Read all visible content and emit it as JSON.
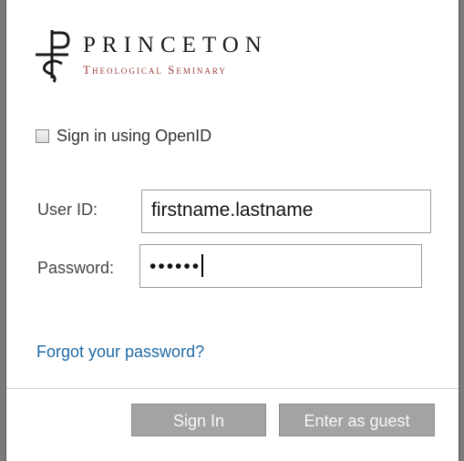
{
  "logo": {
    "name": "PRINCETON",
    "subtitle": "Theological Seminary"
  },
  "openid": {
    "label": "Sign in using OpenID"
  },
  "form": {
    "user_id_label": "User ID:",
    "user_id_value": "firstname.lastname",
    "password_label": "Password:",
    "password_value": "••••••"
  },
  "links": {
    "forgot_password": "Forgot your password?"
  },
  "buttons": {
    "sign_in": "Sign In",
    "guest": "Enter as guest"
  },
  "colors": {
    "link": "#1f6aa5",
    "logo_subtitle": "#9a3a37",
    "button_bg": "#a3a3a3"
  }
}
